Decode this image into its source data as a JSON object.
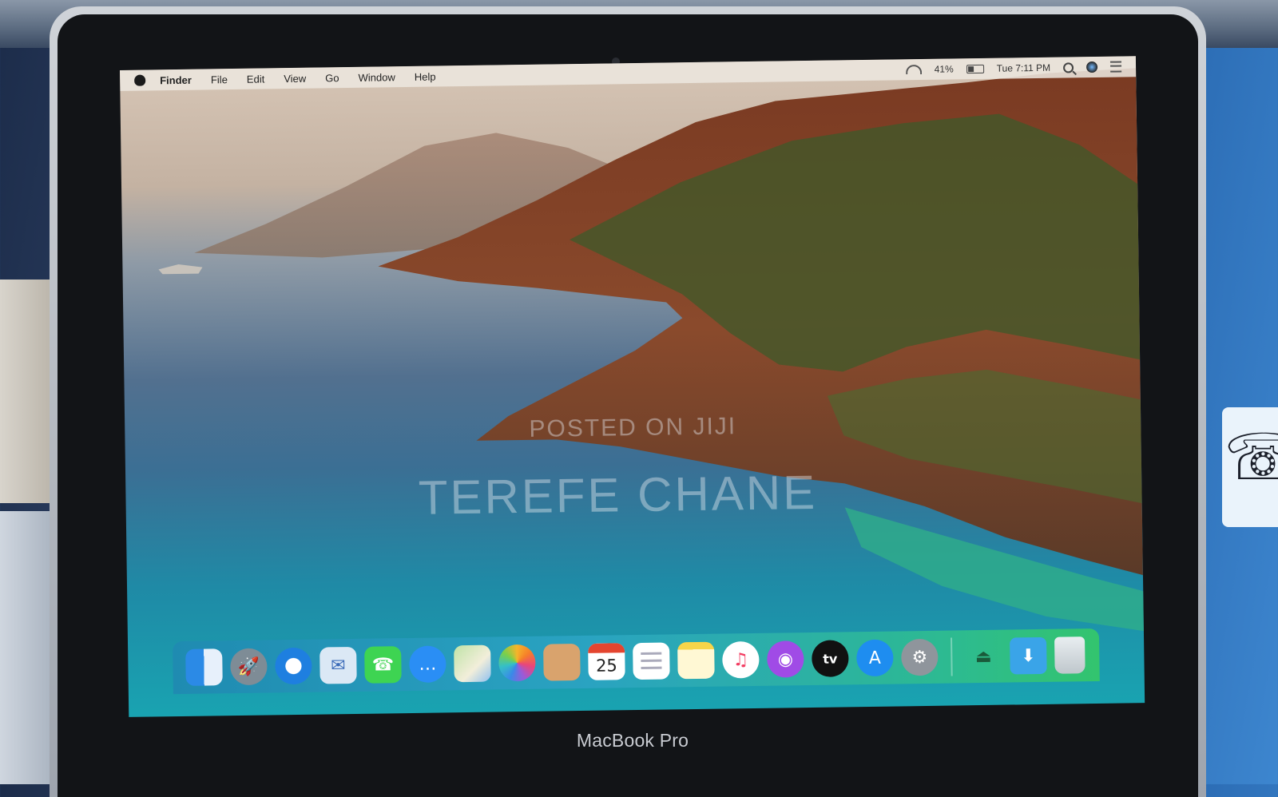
{
  "menubar": {
    "app_name": "Finder",
    "menus": [
      "File",
      "Edit",
      "View",
      "Go",
      "Window",
      "Help"
    ],
    "battery": "41%",
    "clock": "Tue 7:11 PM"
  },
  "watermark": {
    "line1": "POSTED ON JIJI",
    "line2": "TEREFE CHANE"
  },
  "dock": {
    "calendar_day": "25",
    "apps": [
      "finder",
      "launchpad",
      "safari",
      "mail",
      "facetime",
      "messages",
      "maps",
      "photos",
      "contacts",
      "calendar",
      "reminders",
      "notes",
      "music",
      "podcasts",
      "tv",
      "app-store",
      "system-preferences",
      "airdrop",
      "downloads",
      "trash"
    ]
  },
  "device": {
    "model": "MacBook Pro"
  }
}
